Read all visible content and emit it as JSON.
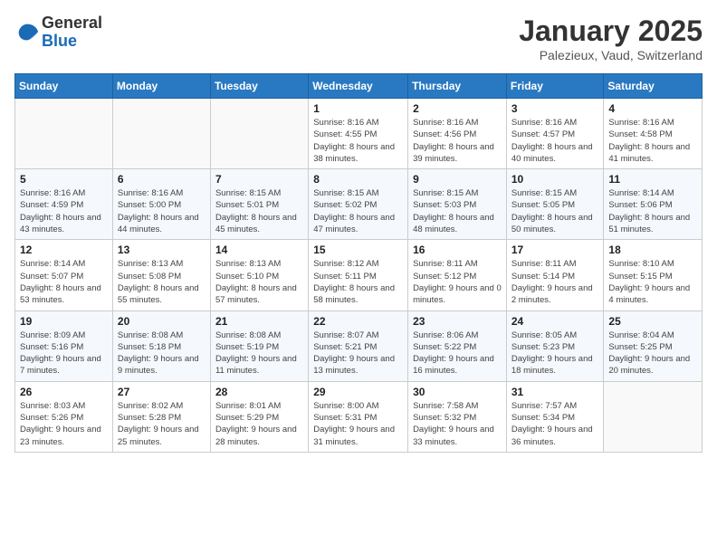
{
  "logo": {
    "general": "General",
    "blue": "Blue"
  },
  "title": "January 2025",
  "subtitle": "Palezieux, Vaud, Switzerland",
  "weekdays": [
    "Sunday",
    "Monday",
    "Tuesday",
    "Wednesday",
    "Thursday",
    "Friday",
    "Saturday"
  ],
  "weeks": [
    [
      {
        "day": "",
        "sunrise": "",
        "sunset": "",
        "daylight": ""
      },
      {
        "day": "",
        "sunrise": "",
        "sunset": "",
        "daylight": ""
      },
      {
        "day": "",
        "sunrise": "",
        "sunset": "",
        "daylight": ""
      },
      {
        "day": "1",
        "sunrise": "Sunrise: 8:16 AM",
        "sunset": "Sunset: 4:55 PM",
        "daylight": "Daylight: 8 hours and 38 minutes."
      },
      {
        "day": "2",
        "sunrise": "Sunrise: 8:16 AM",
        "sunset": "Sunset: 4:56 PM",
        "daylight": "Daylight: 8 hours and 39 minutes."
      },
      {
        "day": "3",
        "sunrise": "Sunrise: 8:16 AM",
        "sunset": "Sunset: 4:57 PM",
        "daylight": "Daylight: 8 hours and 40 minutes."
      },
      {
        "day": "4",
        "sunrise": "Sunrise: 8:16 AM",
        "sunset": "Sunset: 4:58 PM",
        "daylight": "Daylight: 8 hours and 41 minutes."
      }
    ],
    [
      {
        "day": "5",
        "sunrise": "Sunrise: 8:16 AM",
        "sunset": "Sunset: 4:59 PM",
        "daylight": "Daylight: 8 hours and 43 minutes."
      },
      {
        "day": "6",
        "sunrise": "Sunrise: 8:16 AM",
        "sunset": "Sunset: 5:00 PM",
        "daylight": "Daylight: 8 hours and 44 minutes."
      },
      {
        "day": "7",
        "sunrise": "Sunrise: 8:15 AM",
        "sunset": "Sunset: 5:01 PM",
        "daylight": "Daylight: 8 hours and 45 minutes."
      },
      {
        "day": "8",
        "sunrise": "Sunrise: 8:15 AM",
        "sunset": "Sunset: 5:02 PM",
        "daylight": "Daylight: 8 hours and 47 minutes."
      },
      {
        "day": "9",
        "sunrise": "Sunrise: 8:15 AM",
        "sunset": "Sunset: 5:03 PM",
        "daylight": "Daylight: 8 hours and 48 minutes."
      },
      {
        "day": "10",
        "sunrise": "Sunrise: 8:15 AM",
        "sunset": "Sunset: 5:05 PM",
        "daylight": "Daylight: 8 hours and 50 minutes."
      },
      {
        "day": "11",
        "sunrise": "Sunrise: 8:14 AM",
        "sunset": "Sunset: 5:06 PM",
        "daylight": "Daylight: 8 hours and 51 minutes."
      }
    ],
    [
      {
        "day": "12",
        "sunrise": "Sunrise: 8:14 AM",
        "sunset": "Sunset: 5:07 PM",
        "daylight": "Daylight: 8 hours and 53 minutes."
      },
      {
        "day": "13",
        "sunrise": "Sunrise: 8:13 AM",
        "sunset": "Sunset: 5:08 PM",
        "daylight": "Daylight: 8 hours and 55 minutes."
      },
      {
        "day": "14",
        "sunrise": "Sunrise: 8:13 AM",
        "sunset": "Sunset: 5:10 PM",
        "daylight": "Daylight: 8 hours and 57 minutes."
      },
      {
        "day": "15",
        "sunrise": "Sunrise: 8:12 AM",
        "sunset": "Sunset: 5:11 PM",
        "daylight": "Daylight: 8 hours and 58 minutes."
      },
      {
        "day": "16",
        "sunrise": "Sunrise: 8:11 AM",
        "sunset": "Sunset: 5:12 PM",
        "daylight": "Daylight: 9 hours and 0 minutes."
      },
      {
        "day": "17",
        "sunrise": "Sunrise: 8:11 AM",
        "sunset": "Sunset: 5:14 PM",
        "daylight": "Daylight: 9 hours and 2 minutes."
      },
      {
        "day": "18",
        "sunrise": "Sunrise: 8:10 AM",
        "sunset": "Sunset: 5:15 PM",
        "daylight": "Daylight: 9 hours and 4 minutes."
      }
    ],
    [
      {
        "day": "19",
        "sunrise": "Sunrise: 8:09 AM",
        "sunset": "Sunset: 5:16 PM",
        "daylight": "Daylight: 9 hours and 7 minutes."
      },
      {
        "day": "20",
        "sunrise": "Sunrise: 8:08 AM",
        "sunset": "Sunset: 5:18 PM",
        "daylight": "Daylight: 9 hours and 9 minutes."
      },
      {
        "day": "21",
        "sunrise": "Sunrise: 8:08 AM",
        "sunset": "Sunset: 5:19 PM",
        "daylight": "Daylight: 9 hours and 11 minutes."
      },
      {
        "day": "22",
        "sunrise": "Sunrise: 8:07 AM",
        "sunset": "Sunset: 5:21 PM",
        "daylight": "Daylight: 9 hours and 13 minutes."
      },
      {
        "day": "23",
        "sunrise": "Sunrise: 8:06 AM",
        "sunset": "Sunset: 5:22 PM",
        "daylight": "Daylight: 9 hours and 16 minutes."
      },
      {
        "day": "24",
        "sunrise": "Sunrise: 8:05 AM",
        "sunset": "Sunset: 5:23 PM",
        "daylight": "Daylight: 9 hours and 18 minutes."
      },
      {
        "day": "25",
        "sunrise": "Sunrise: 8:04 AM",
        "sunset": "Sunset: 5:25 PM",
        "daylight": "Daylight: 9 hours and 20 minutes."
      }
    ],
    [
      {
        "day": "26",
        "sunrise": "Sunrise: 8:03 AM",
        "sunset": "Sunset: 5:26 PM",
        "daylight": "Daylight: 9 hours and 23 minutes."
      },
      {
        "day": "27",
        "sunrise": "Sunrise: 8:02 AM",
        "sunset": "Sunset: 5:28 PM",
        "daylight": "Daylight: 9 hours and 25 minutes."
      },
      {
        "day": "28",
        "sunrise": "Sunrise: 8:01 AM",
        "sunset": "Sunset: 5:29 PM",
        "daylight": "Daylight: 9 hours and 28 minutes."
      },
      {
        "day": "29",
        "sunrise": "Sunrise: 8:00 AM",
        "sunset": "Sunset: 5:31 PM",
        "daylight": "Daylight: 9 hours and 31 minutes."
      },
      {
        "day": "30",
        "sunrise": "Sunrise: 7:58 AM",
        "sunset": "Sunset: 5:32 PM",
        "daylight": "Daylight: 9 hours and 33 minutes."
      },
      {
        "day": "31",
        "sunrise": "Sunrise: 7:57 AM",
        "sunset": "Sunset: 5:34 PM",
        "daylight": "Daylight: 9 hours and 36 minutes."
      },
      {
        "day": "",
        "sunrise": "",
        "sunset": "",
        "daylight": ""
      }
    ]
  ]
}
